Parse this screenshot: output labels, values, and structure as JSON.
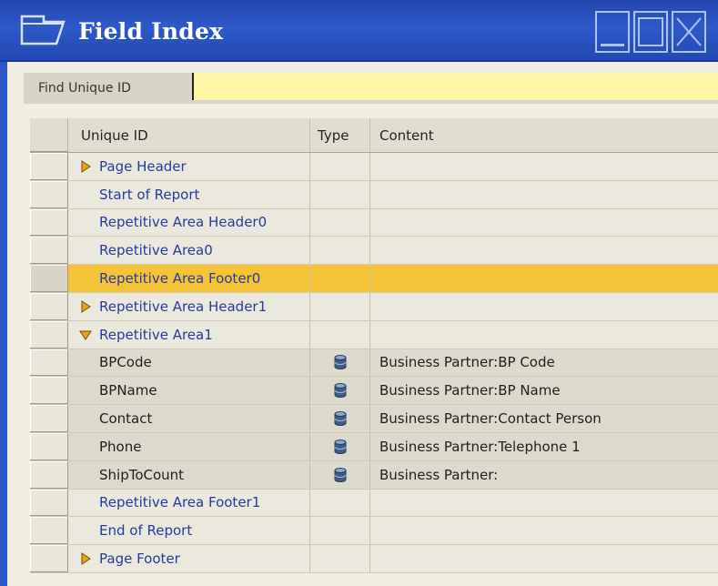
{
  "window": {
    "title": "Field Index"
  },
  "find": {
    "label": "Find Unique ID",
    "value": ""
  },
  "grid": {
    "columns": [
      "Unique ID",
      "Type",
      "Content"
    ],
    "rows": [
      {
        "id": "Page Header",
        "kind": "section",
        "expander": "collapsed",
        "content": ""
      },
      {
        "id": "Start of Report",
        "kind": "section",
        "expander": "none",
        "content": ""
      },
      {
        "id": "Repetitive Area Header0",
        "kind": "section",
        "expander": "none",
        "content": ""
      },
      {
        "id": "Repetitive Area0",
        "kind": "section",
        "expander": "none",
        "content": ""
      },
      {
        "id": "Repetitive Area Footer0",
        "kind": "section",
        "expander": "none",
        "content": "",
        "selected": true
      },
      {
        "id": "Repetitive Area Header1",
        "kind": "section",
        "expander": "collapsed",
        "content": ""
      },
      {
        "id": "Repetitive Area1",
        "kind": "section",
        "expander": "expanded",
        "content": ""
      },
      {
        "id": "BPCode",
        "kind": "field",
        "type_icon": "database-icon",
        "content": "Business Partner:BP Code"
      },
      {
        "id": "BPName",
        "kind": "field",
        "type_icon": "database-icon",
        "content": "Business Partner:BP Name"
      },
      {
        "id": "Contact",
        "kind": "field",
        "type_icon": "database-icon",
        "content": "Business Partner:Contact Person"
      },
      {
        "id": "Phone",
        "kind": "field",
        "type_icon": "database-icon",
        "content": "Business Partner:Telephone 1"
      },
      {
        "id": "ShipToCount",
        "kind": "field",
        "type_icon": "database-icon",
        "content": "Business Partner:"
      },
      {
        "id": "Repetitive Area Footer1",
        "kind": "section",
        "expander": "none",
        "content": ""
      },
      {
        "id": "End of Report",
        "kind": "section",
        "expander": "none",
        "content": ""
      },
      {
        "id": "Page Footer",
        "kind": "section",
        "expander": "collapsed",
        "content": ""
      }
    ]
  },
  "colors": {
    "title_bar": "#2e59c8",
    "find_input_bg": "#fff7a4",
    "selected_row": "#f5c337",
    "section_text": "#233c9c",
    "expander_arrow": "#e8a317"
  }
}
